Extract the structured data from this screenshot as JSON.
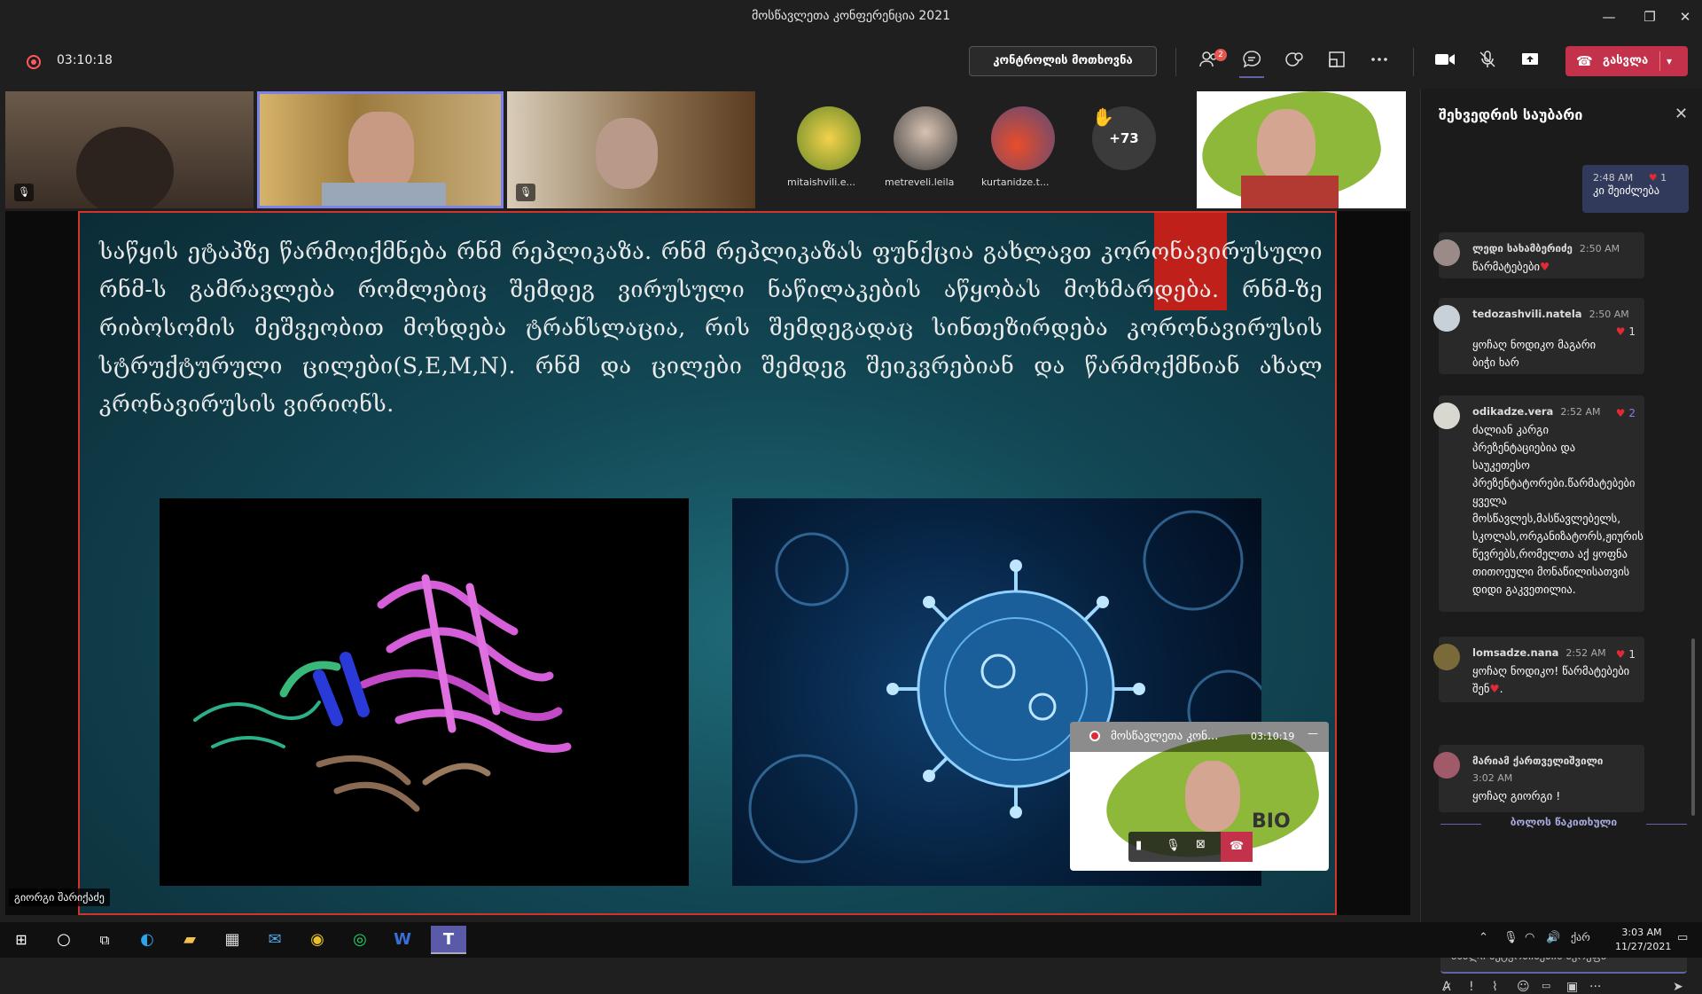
{
  "window": {
    "title": "მოსწავლეთა კონფერენცია 2021",
    "min": "—",
    "restore": "❐",
    "close": "✕"
  },
  "toolbar": {
    "elapsed": "03:10:18",
    "control_label": "კონტროლის მოთხოვნა",
    "participants_badge": "2",
    "leave_label": "გასვლა"
  },
  "participants": [
    {
      "name": "mitaishvili.e..."
    },
    {
      "name": "metreveli.leila"
    },
    {
      "name": "kurtanidze.t..."
    }
  ],
  "more_count": "+73",
  "slide": {
    "text": "საწყის ეტაპზე წარმოიქმნება რნმ რეპლიკაზა. რნმ რეპლიკაზას ფუნქცია გახლავთ კორონავირუსული რნმ-ს გამრავლება რომლებიც შემდეგ ვირუსული ნაწილაკების აწყობას მოხმარდება. რნმ-ზე რიბოსომის მეშვეობით მოხდება ტრანსლაცია, რის შემდეგადაც სინთეზირდება კორონავირუსის სტრუქტურული ცილები(S,E,M,N). რნმ და ცილები შემდეგ შეიკვრებიან და წარმოქმნიან ახალ კრონავირუსის ვირიონს.",
    "presenter": "გიორგი შარიქაძე"
  },
  "mini_window": {
    "title": "მოსწავლეთა კონ...",
    "time": "03:10:19",
    "logo_text": "BIO"
  },
  "chat": {
    "title": "შეხვედრის საუბარი",
    "my_message": {
      "time": "2:48 AM",
      "text": "კი შეიძლება",
      "reactions": "1"
    },
    "messages": [
      {
        "name": "ლედი სახამბერიძე",
        "time": "2:50 AM",
        "text": "წარმატებები",
        "reactions": ""
      },
      {
        "name": "tedozashvili.natela",
        "time": "2:50 AM",
        "text": "ყოჩაღ ნოდიკო მაგარი ბიჭი ხარ",
        "reactions": "1"
      },
      {
        "name": "odikadze.vera",
        "time": "2:52 AM",
        "text": "ძალიან კარგი პრეზენტაციებია და საუკეთესო პრეზენტატორები.წარმატებები ყველა მოსწავლეს,მასწავლებელს, სკოლას,ორგანიზატორს,ჟიურის წევრებს,რომელთა აქ ყოფნა თითოეული მონაწილისათვის დიდი გაკვეთილია.",
        "reactions": "2"
      },
      {
        "name": "lomsadze.nana",
        "time": "2:52 AM",
        "text": "ყოჩაღ ნოდიკო! წარმატებები შენ",
        "reactions": "1"
      },
      {
        "name": "მარიამ ქართველიშვილი",
        "time": "3:02 AM",
        "text": "ყოჩაღ გიორგი !",
        "reactions": ""
      }
    ],
    "last_read": "ბოლოს წაკითხული",
    "new_message_placeholder": "ახალი შეტყობინების აკრეფა"
  },
  "taskbar": {
    "time": "3:03 AM",
    "date": "11/27/2021",
    "lang": "ქარ"
  },
  "colors": {
    "accent": "#6264a7",
    "leave": "#c4314b",
    "slide_border": "#d2342c"
  }
}
